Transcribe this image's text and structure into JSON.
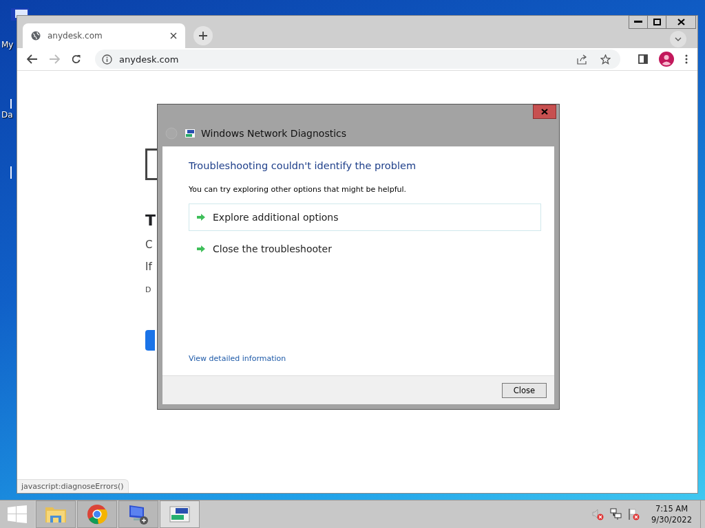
{
  "desktop": {
    "icons": [
      {
        "label": "My"
      },
      {
        "label": "Da"
      }
    ]
  },
  "browser": {
    "tabs": [
      {
        "title": "anydesk.com",
        "selected": true
      }
    ],
    "address": "anydesk.com",
    "page_behind": [
      {
        "kind": "heading",
        "text": "T"
      },
      {
        "kind": "body",
        "text": "C"
      },
      {
        "kind": "body",
        "text": "If"
      },
      {
        "kind": "small",
        "text": "D"
      }
    ],
    "status_url": "javascript:diagnoseErrors()"
  },
  "dialog": {
    "title": "Windows Network Diagnostics",
    "heading": "Troubleshooting couldn't identify the problem",
    "message": "You can try exploring other options that might be helpful.",
    "options": [
      {
        "label": "Explore additional options",
        "selected": true
      },
      {
        "label": "Close the troubleshooter",
        "selected": false
      }
    ],
    "link": "View detailed information",
    "buttons": [
      "Close"
    ]
  },
  "taskbar": {
    "apps": [
      {
        "kind": "start",
        "selected": false
      },
      {
        "kind": "explorer",
        "selected": false
      },
      {
        "kind": "chrome",
        "selected": false
      },
      {
        "kind": "remote",
        "selected": false
      },
      {
        "kind": "network",
        "selected": true
      }
    ],
    "clock": {
      "time": "7:15 AM",
      "date": "9/30/2022"
    }
  }
}
